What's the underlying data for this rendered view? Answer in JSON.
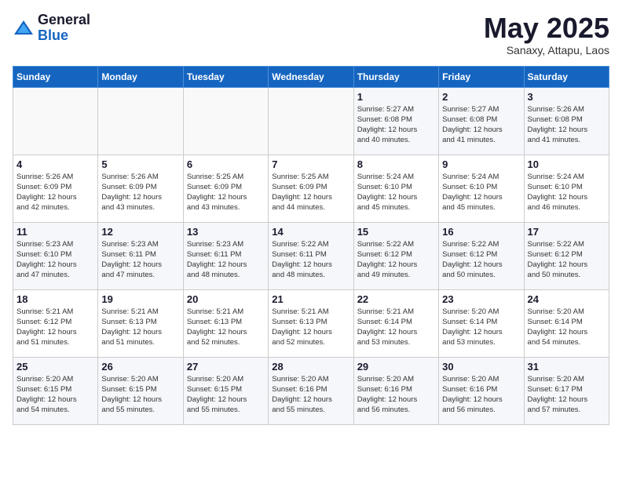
{
  "header": {
    "logo_general": "General",
    "logo_blue": "Blue",
    "month_title": "May 2025",
    "subtitle": "Sanaxy, Attapu, Laos"
  },
  "weekdays": [
    "Sunday",
    "Monday",
    "Tuesday",
    "Wednesday",
    "Thursday",
    "Friday",
    "Saturday"
  ],
  "weeks": [
    [
      {
        "day": "",
        "info": ""
      },
      {
        "day": "",
        "info": ""
      },
      {
        "day": "",
        "info": ""
      },
      {
        "day": "",
        "info": ""
      },
      {
        "day": "1",
        "info": "Sunrise: 5:27 AM\nSunset: 6:08 PM\nDaylight: 12 hours\nand 40 minutes."
      },
      {
        "day": "2",
        "info": "Sunrise: 5:27 AM\nSunset: 6:08 PM\nDaylight: 12 hours\nand 41 minutes."
      },
      {
        "day": "3",
        "info": "Sunrise: 5:26 AM\nSunset: 6:08 PM\nDaylight: 12 hours\nand 41 minutes."
      }
    ],
    [
      {
        "day": "4",
        "info": "Sunrise: 5:26 AM\nSunset: 6:09 PM\nDaylight: 12 hours\nand 42 minutes."
      },
      {
        "day": "5",
        "info": "Sunrise: 5:26 AM\nSunset: 6:09 PM\nDaylight: 12 hours\nand 43 minutes."
      },
      {
        "day": "6",
        "info": "Sunrise: 5:25 AM\nSunset: 6:09 PM\nDaylight: 12 hours\nand 43 minutes."
      },
      {
        "day": "7",
        "info": "Sunrise: 5:25 AM\nSunset: 6:09 PM\nDaylight: 12 hours\nand 44 minutes."
      },
      {
        "day": "8",
        "info": "Sunrise: 5:24 AM\nSunset: 6:10 PM\nDaylight: 12 hours\nand 45 minutes."
      },
      {
        "day": "9",
        "info": "Sunrise: 5:24 AM\nSunset: 6:10 PM\nDaylight: 12 hours\nand 45 minutes."
      },
      {
        "day": "10",
        "info": "Sunrise: 5:24 AM\nSunset: 6:10 PM\nDaylight: 12 hours\nand 46 minutes."
      }
    ],
    [
      {
        "day": "11",
        "info": "Sunrise: 5:23 AM\nSunset: 6:10 PM\nDaylight: 12 hours\nand 47 minutes."
      },
      {
        "day": "12",
        "info": "Sunrise: 5:23 AM\nSunset: 6:11 PM\nDaylight: 12 hours\nand 47 minutes."
      },
      {
        "day": "13",
        "info": "Sunrise: 5:23 AM\nSunset: 6:11 PM\nDaylight: 12 hours\nand 48 minutes."
      },
      {
        "day": "14",
        "info": "Sunrise: 5:22 AM\nSunset: 6:11 PM\nDaylight: 12 hours\nand 48 minutes."
      },
      {
        "day": "15",
        "info": "Sunrise: 5:22 AM\nSunset: 6:12 PM\nDaylight: 12 hours\nand 49 minutes."
      },
      {
        "day": "16",
        "info": "Sunrise: 5:22 AM\nSunset: 6:12 PM\nDaylight: 12 hours\nand 50 minutes."
      },
      {
        "day": "17",
        "info": "Sunrise: 5:22 AM\nSunset: 6:12 PM\nDaylight: 12 hours\nand 50 minutes."
      }
    ],
    [
      {
        "day": "18",
        "info": "Sunrise: 5:21 AM\nSunset: 6:12 PM\nDaylight: 12 hours\nand 51 minutes."
      },
      {
        "day": "19",
        "info": "Sunrise: 5:21 AM\nSunset: 6:13 PM\nDaylight: 12 hours\nand 51 minutes."
      },
      {
        "day": "20",
        "info": "Sunrise: 5:21 AM\nSunset: 6:13 PM\nDaylight: 12 hours\nand 52 minutes."
      },
      {
        "day": "21",
        "info": "Sunrise: 5:21 AM\nSunset: 6:13 PM\nDaylight: 12 hours\nand 52 minutes."
      },
      {
        "day": "22",
        "info": "Sunrise: 5:21 AM\nSunset: 6:14 PM\nDaylight: 12 hours\nand 53 minutes."
      },
      {
        "day": "23",
        "info": "Sunrise: 5:20 AM\nSunset: 6:14 PM\nDaylight: 12 hours\nand 53 minutes."
      },
      {
        "day": "24",
        "info": "Sunrise: 5:20 AM\nSunset: 6:14 PM\nDaylight: 12 hours\nand 54 minutes."
      }
    ],
    [
      {
        "day": "25",
        "info": "Sunrise: 5:20 AM\nSunset: 6:15 PM\nDaylight: 12 hours\nand 54 minutes."
      },
      {
        "day": "26",
        "info": "Sunrise: 5:20 AM\nSunset: 6:15 PM\nDaylight: 12 hours\nand 55 minutes."
      },
      {
        "day": "27",
        "info": "Sunrise: 5:20 AM\nSunset: 6:15 PM\nDaylight: 12 hours\nand 55 minutes."
      },
      {
        "day": "28",
        "info": "Sunrise: 5:20 AM\nSunset: 6:16 PM\nDaylight: 12 hours\nand 55 minutes."
      },
      {
        "day": "29",
        "info": "Sunrise: 5:20 AM\nSunset: 6:16 PM\nDaylight: 12 hours\nand 56 minutes."
      },
      {
        "day": "30",
        "info": "Sunrise: 5:20 AM\nSunset: 6:16 PM\nDaylight: 12 hours\nand 56 minutes."
      },
      {
        "day": "31",
        "info": "Sunrise: 5:20 AM\nSunset: 6:17 PM\nDaylight: 12 hours\nand 57 minutes."
      }
    ]
  ]
}
